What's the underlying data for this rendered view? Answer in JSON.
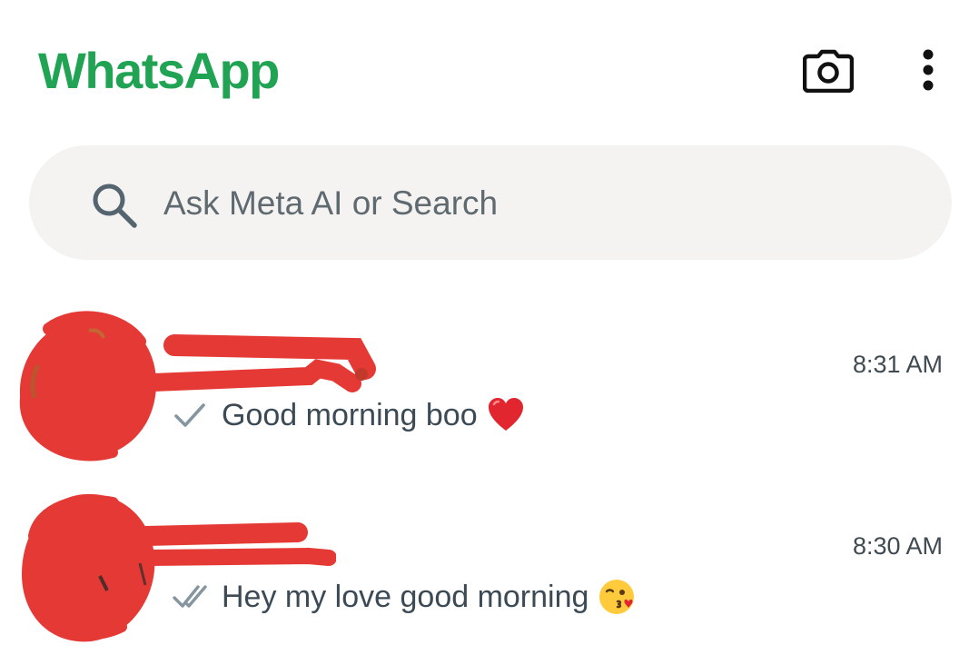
{
  "header": {
    "title": "WhatsApp",
    "camera_icon": "camera-icon",
    "menu_icon": "more-vertical-icon"
  },
  "search": {
    "placeholder": "Ask Meta AI or Search",
    "icon": "search-icon"
  },
  "chats": [
    {
      "name_redacted": true,
      "time": "8:31 AM",
      "preview": "Good morning boo",
      "status": "sent-single-check",
      "emoji": "red-heart"
    },
    {
      "name_redacted": true,
      "time": "8:30 AM",
      "preview": "Hey my love good morning",
      "status": "delivered-double-check",
      "emoji": "face-blowing-kiss"
    }
  ],
  "colors": {
    "brand_green": "#21a354",
    "search_bg": "#f4f3f1",
    "redaction_red": "#e53935",
    "text_primary": "#3b4a54",
    "tick_grey": "#8696a0"
  }
}
